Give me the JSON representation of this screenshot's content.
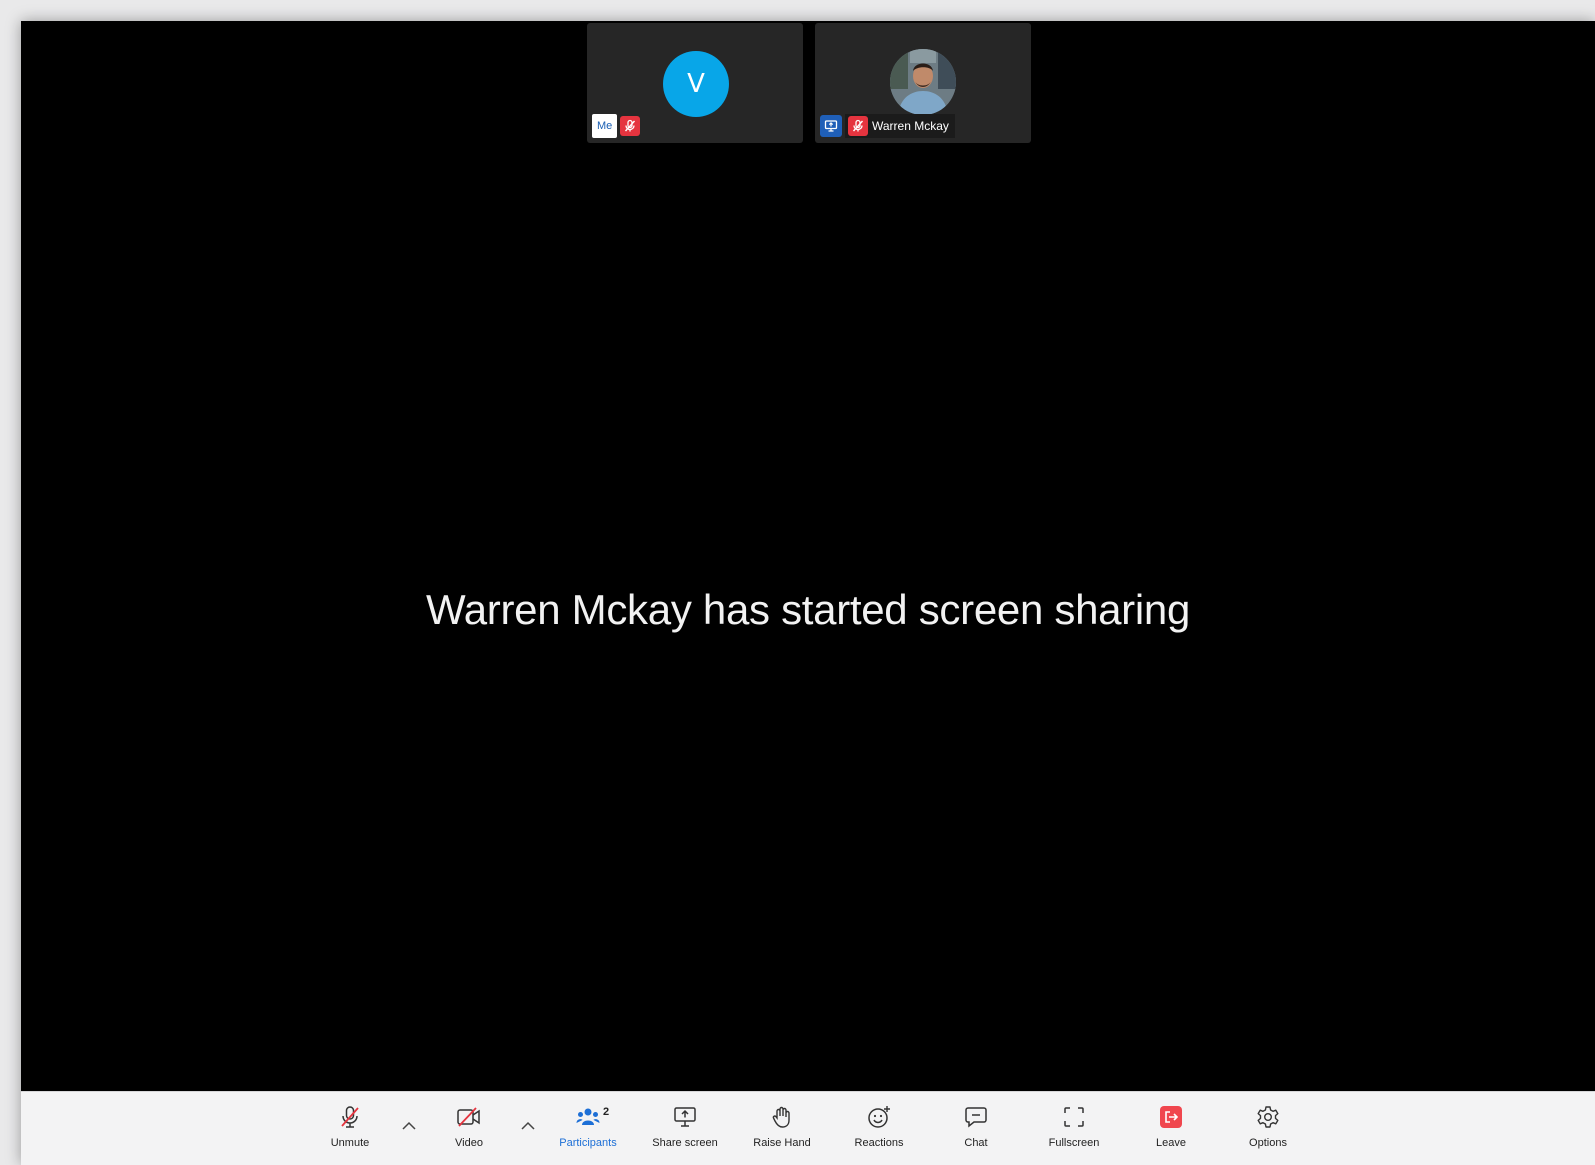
{
  "participants": {
    "self": {
      "avatar_letter": "V",
      "tag": "Me"
    },
    "remote": {
      "name": "Warren Mckay"
    }
  },
  "stage": {
    "message": "Warren Mckay has started screen sharing"
  },
  "toolbar": {
    "unmute": "Unmute",
    "video": "Video",
    "participants": "Participants",
    "participants_count": "2",
    "share_screen": "Share screen",
    "raise_hand": "Raise Hand",
    "reactions": "Reactions",
    "chat": "Chat",
    "fullscreen": "Fullscreen",
    "leave": "Leave",
    "options": "Options"
  },
  "colors": {
    "avatar": "#08a6e8",
    "muted_red": "#e5343f",
    "share_blue": "#1f5fb8",
    "active_blue": "#1d6fd6",
    "leave_red": "#f0464e"
  }
}
